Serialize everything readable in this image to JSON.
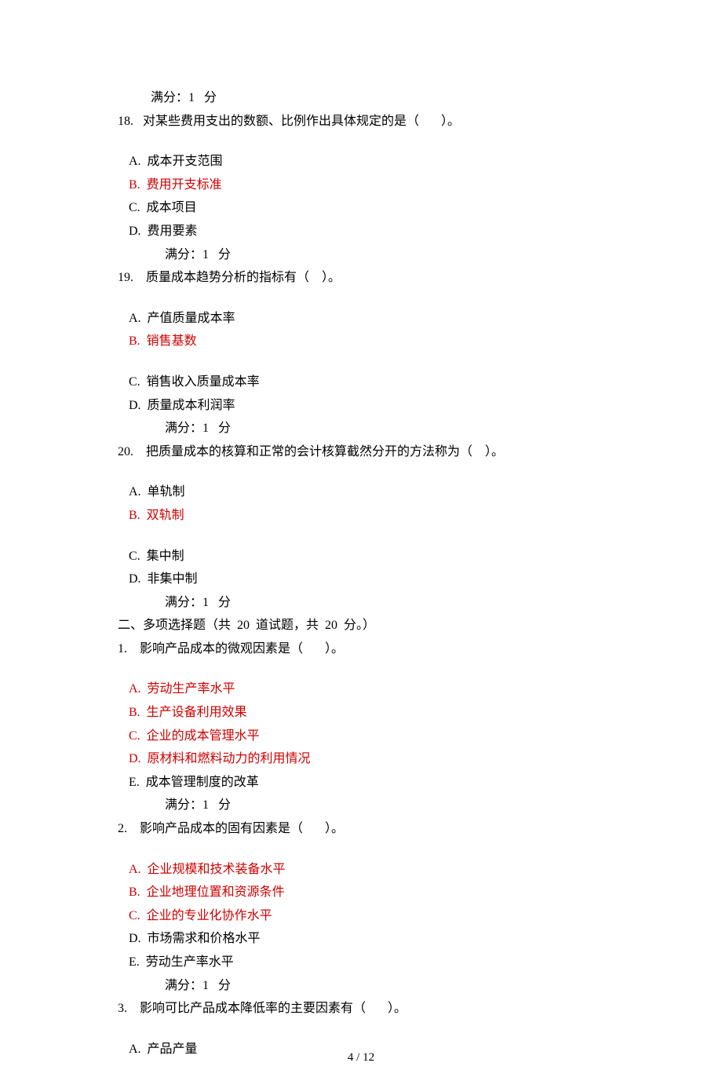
{
  "top_score": "满分：1   分",
  "q18": {
    "stem": "18.   对某些费用支出的数额、比例作出具体规定的是（       ）。",
    "A": "A.  成本开支范围",
    "B": "B.  费用开支标准",
    "C": "C.  成本项目",
    "D": "D.  费用要素",
    "score": "满分：1   分"
  },
  "q19": {
    "stem": "19.    质量成本趋势分析的指标有（    ）。",
    "A": "A.  产值质量成本率",
    "B": "B.  销售基数",
    "C": "C.  销售收入质量成本率",
    "D": "D.  质量成本利润率",
    "score": "满分：1   分"
  },
  "q20": {
    "stem": "20.    把质量成本的核算和正常的会计核算截然分开的方法称为（    ）。",
    "A": "A.  单轨制",
    "B": "B.  双轨制",
    "C": "C.  集中制",
    "D": "D.  非集中制",
    "score": "满分：1   分"
  },
  "section2": "二、多项选择题（共  20  道试题，共  20  分。）",
  "m1": {
    "stem": "1.    影响产品成本的微观因素是（       ）。",
    "A": "A.  劳动生产率水平",
    "B": "B.  生产设备利用效果",
    "C": "C.  企业的成本管理水平",
    "D": "D.  原材料和燃料动力的利用情况",
    "E": "E.  成本管理制度的改革",
    "score": "满分：1   分"
  },
  "m2": {
    "stem": "2.    影响产品成本的固有因素是（       ）。",
    "A": "A.  企业规模和技术装备水平",
    "B": "B.  企业地理位置和资源条件",
    "C": "C.  企业的专业化协作水平",
    "D": "D.  市场需求和价格水平",
    "E": "E.  劳动生产率水平",
    "score": "满分：1   分"
  },
  "m3": {
    "stem": "3.    影响可比产品成本降低率的主要因素有（       ）。",
    "A": "A.  产品产量"
  },
  "footer": "4  /  12"
}
